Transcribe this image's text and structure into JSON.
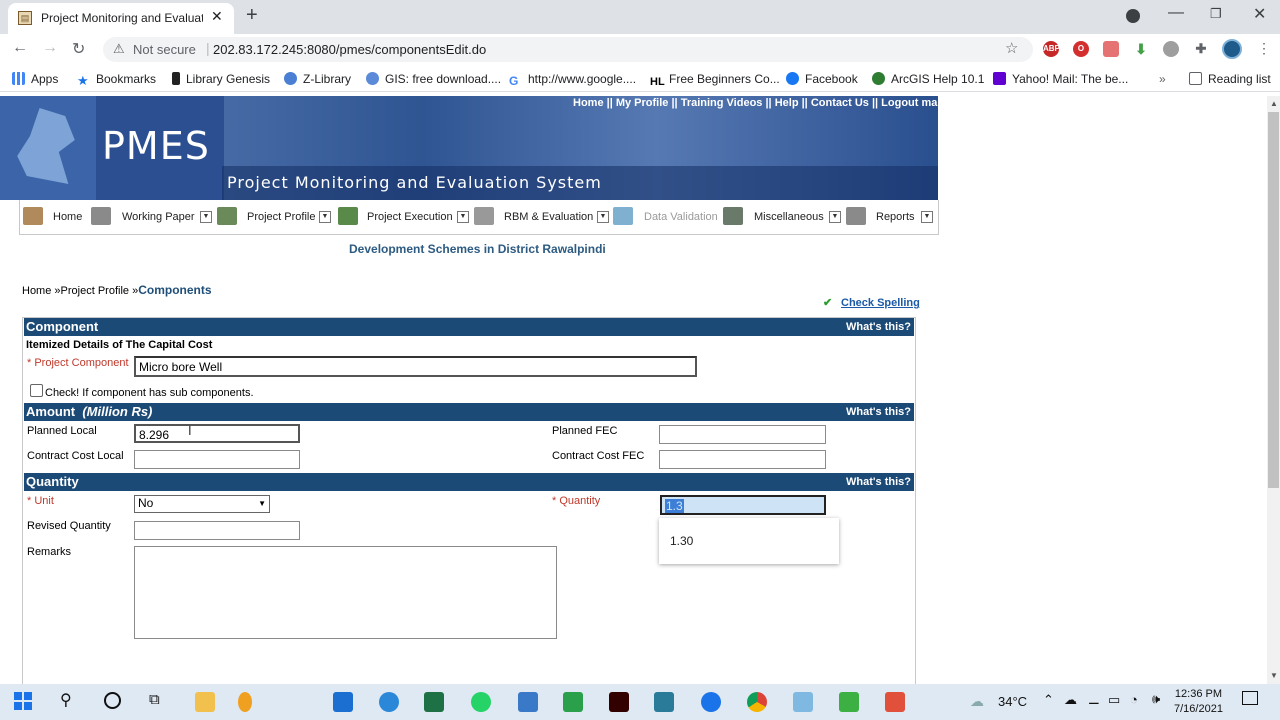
{
  "browser": {
    "tab_title": "Project Monitoring and Evaluatio",
    "not_secure": "Not secure",
    "url": "202.83.172.245:8080/pmes/componentsEdit.do",
    "bookmarks": [
      "Apps",
      "Bookmarks",
      "Library Genesis",
      "Z-Library",
      "GIS: free download....",
      "http://www.google....",
      "Free Beginners Co...",
      "Facebook",
      "ArcGIS Help 10.1",
      "Yahoo! Mail: The be..."
    ],
    "reading_list": "Reading list",
    "extension_labels": [
      "ABP"
    ]
  },
  "banner": {
    "logo": "PMES",
    "subtitle": "Project Monitoring and Evaluation System",
    "top_links": [
      "Home",
      "My Profile",
      "Training Videos",
      "Help",
      "Contact Us",
      "Logout master"
    ],
    "link_separator": "||"
  },
  "menu": [
    "Home",
    "Working Paper",
    "Project Profile",
    "Project Execution",
    "RBM & Evaluation",
    "Data Validation",
    "Miscellaneous",
    "Reports"
  ],
  "page": {
    "district_title": "Development Schemes in District Rawalpindi",
    "breadcrumb": {
      "home": "Home",
      "sep": "»",
      "profile": "Project Profile",
      "current": "Components"
    },
    "check_spelling": "Check Spelling",
    "whats_this": "What's this?"
  },
  "component": {
    "header": "Component",
    "subtitle": "Itemized Details of The Capital Cost",
    "project_component_label": "Project Component",
    "project_component_value": "Micro bore Well",
    "sub_components_label": "Check! If component has sub components."
  },
  "amount": {
    "header": "Amount",
    "unit": "(Million Rs)",
    "planned_local_label": "Planned Local",
    "planned_local_value": "8.296",
    "planned_fec_label": "Planned FEC",
    "contract_local_label": "Contract Cost Local",
    "contract_fec_label": "Contract Cost FEC"
  },
  "quantity": {
    "header": "Quantity",
    "unit_label": "Unit",
    "unit_value": "No",
    "quantity_label": "Quantity",
    "quantity_value": "1.3",
    "revised_label": "Revised Quantity",
    "remarks_label": "Remarks",
    "autocomplete": "1.30"
  },
  "taskbar": {
    "temperature": "34°C",
    "time": "12:36 PM",
    "date": "7/16/2021"
  }
}
